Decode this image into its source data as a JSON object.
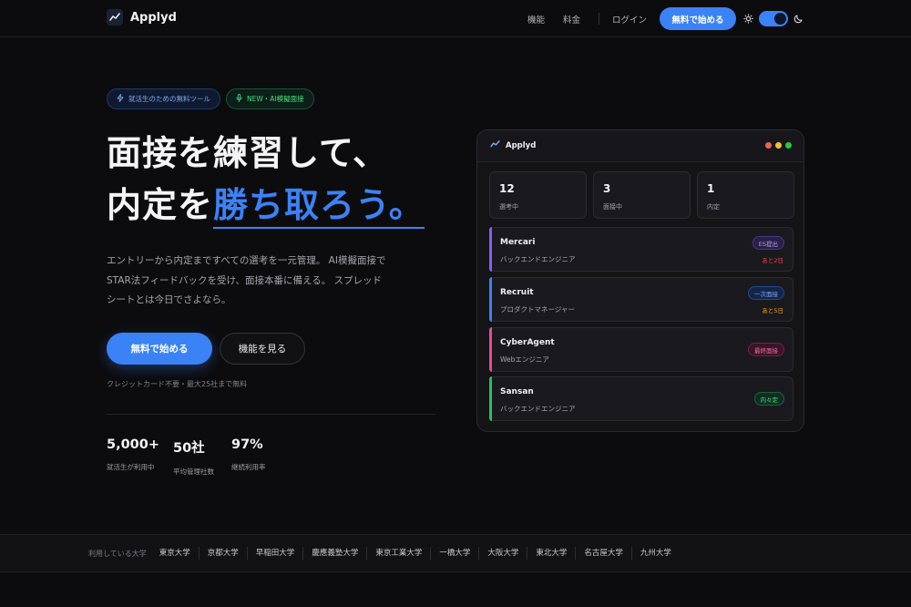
{
  "brand": {
    "name": "Applyd"
  },
  "nav": {
    "features": "機能",
    "pricing": "料金",
    "login": "ログイン",
    "cta": "無料で始める"
  },
  "hero": {
    "badge_primary": "就活生のための無料ツール",
    "badge_secondary": "NEW・AI模擬面接",
    "title_line1": "面接を練習して、",
    "title_line2_prefix": "内定を",
    "title_line2_accent": "勝ち取ろう。",
    "description": "エントリーから内定まですべての選考を一元管理。 AI模擬面接でSTAR法フィードバックを受け、面接本番に備える。 スプレッドシートとは今日でさよなら。",
    "cta_primary": "無料で始める",
    "cta_secondary": "機能を見る",
    "note": "クレジットカード不要・最大25社まで無料"
  },
  "stats": [
    {
      "value": "5,000+",
      "label": "就活生が利用中"
    },
    {
      "value": "50社",
      "label": "平均管理社数"
    },
    {
      "value": "97%",
      "label": "継続利用率"
    }
  ],
  "mockup": {
    "brand": "Applyd",
    "stats": [
      {
        "value": "12",
        "label": "選考中"
      },
      {
        "value": "3",
        "label": "面接中"
      },
      {
        "value": "1",
        "label": "内定"
      }
    ],
    "companies": [
      {
        "name": "Mercari",
        "role": "バックエンドエンジニア",
        "status": "ES提出",
        "due": "あと2日",
        "color": "#8b5cf6"
      },
      {
        "name": "Recruit",
        "role": "プロダクトマネージャー",
        "status": "一次面接",
        "due": "あと5日",
        "color": "#3b82f6"
      },
      {
        "name": "CyberAgent",
        "role": "Webエンジニア",
        "status": "最終面接",
        "due": "",
        "color": "#ec4899"
      },
      {
        "name": "Sansan",
        "role": "バックエンドエンジニア",
        "status": "内々定",
        "due": "",
        "color": "#22c55e"
      }
    ]
  },
  "universities": {
    "label": "利用している大学",
    "items": [
      "東京大学",
      "京都大学",
      "早稲田大学",
      "慶應義塾大学",
      "東京工業大学",
      "一橋大学",
      "大阪大学",
      "東北大学",
      "名古屋大学",
      "九州大学"
    ]
  },
  "colors": {
    "accent": "#3b82f6",
    "background": "#0c0c0e",
    "due_red": "#ef4444",
    "due_orange": "#f59e0b"
  },
  "icons": {
    "logo": "trend-line-icon",
    "badge_primary": "sparkle-icon",
    "badge_secondary": "microphone-icon",
    "theme_light": "sun-icon",
    "theme_dark": "moon-icon"
  }
}
